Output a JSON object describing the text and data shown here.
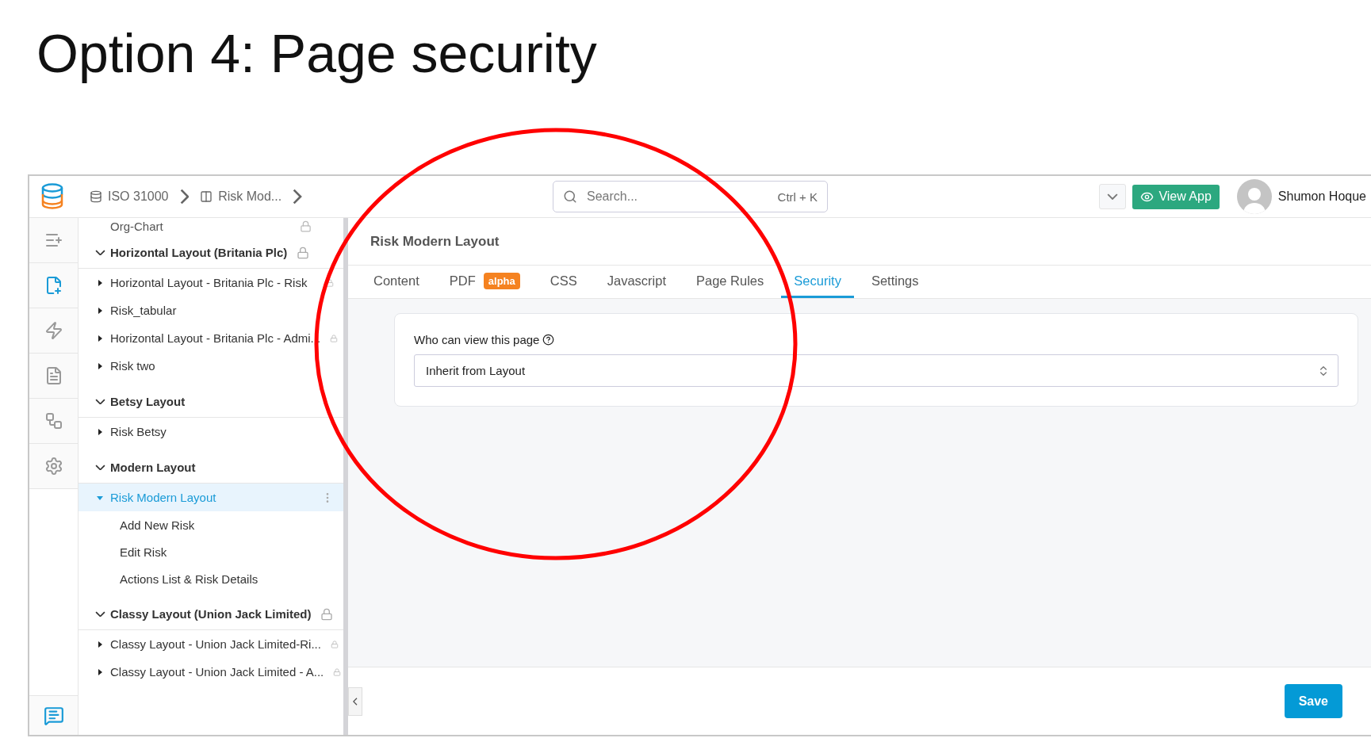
{
  "slide_title": "Option 4: Page security",
  "topbar": {
    "breadcrumbs": [
      "ISO 31000",
      "Risk Mod..."
    ],
    "search": {
      "placeholder": "Search...",
      "shortcut": "Ctrl + K"
    },
    "view_app": "View App",
    "user": "Shumon Hoque"
  },
  "rail": [
    {
      "selected": false
    },
    {
      "selected": true
    },
    {
      "selected": false
    },
    {
      "selected": false
    },
    {
      "selected": false
    },
    {
      "selected": false
    }
  ],
  "tree": {
    "partial_item": {
      "label": "Org-Chart",
      "locked": true
    },
    "groups": [
      {
        "label": "Horizontal Layout (Britania Plc)",
        "expanded": true,
        "locked": true,
        "children": [
          {
            "label": "Horizontal Layout - Britania Plc - Risk",
            "expanded": false,
            "selected": false,
            "locked": true
          },
          {
            "label": "Risk_tabular",
            "expanded": false,
            "selected": false,
            "locked": false
          },
          {
            "label": "Horizontal Layout - Britania Plc - Admi...",
            "expanded": false,
            "selected": false,
            "locked": true
          },
          {
            "label": "Risk two",
            "expanded": false,
            "selected": false,
            "locked": false
          }
        ]
      },
      {
        "label": "Betsy Layout",
        "expanded": true,
        "locked": false,
        "children": [
          {
            "label": "Risk Betsy",
            "expanded": false,
            "selected": false,
            "locked": false
          }
        ]
      },
      {
        "label": "Modern Layout",
        "expanded": true,
        "locked": false,
        "children": [
          {
            "label": "Risk Modern Layout",
            "expanded": true,
            "selected": true,
            "locked": false,
            "children": [
              {
                "label": "Add New Risk",
                "selected": false
              },
              {
                "label": "Edit Risk",
                "selected": false
              },
              {
                "label": "Actions List & Risk Details",
                "selected": false
              }
            ]
          }
        ]
      },
      {
        "label": "Classy Layout (Union Jack Limited)",
        "expanded": true,
        "locked": true,
        "children": [
          {
            "label": "Classy Layout - Union Jack Limited-Ri...",
            "expanded": false,
            "selected": false,
            "locked": true
          },
          {
            "label": "Classy Layout - Union Jack Limited - A...",
            "expanded": false,
            "selected": false,
            "locked": true
          }
        ]
      }
    ]
  },
  "page_title": "Risk Modern Layout",
  "tabs": [
    {
      "label": "Content",
      "selected": false
    },
    {
      "label": "PDF",
      "badge": "alpha",
      "selected": false
    },
    {
      "label": "CSS",
      "selected": false
    },
    {
      "label": "Javascript",
      "selected": false
    },
    {
      "label": "Page Rules",
      "selected": false
    },
    {
      "label": "Security",
      "selected": true
    },
    {
      "label": "Settings",
      "selected": false
    }
  ],
  "security": {
    "label": "Who can view this page",
    "value": "Inherit from Layout"
  },
  "save": "Save"
}
